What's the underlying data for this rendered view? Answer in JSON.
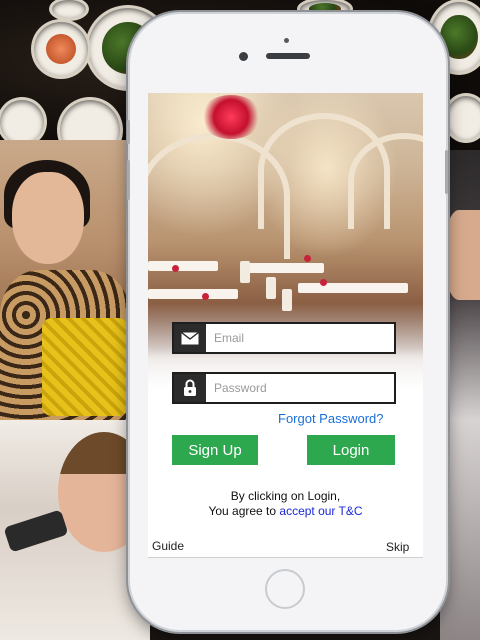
{
  "login": {
    "email_placeholder": "Email",
    "password_placeholder": "Password",
    "forgot_password": "Forgot Password?",
    "signup_label": "Sign Up",
    "login_label": "Login"
  },
  "terms": {
    "line1": "By clicking on Login,",
    "line2_prefix": "You agree to ",
    "link": "accept our T&C"
  },
  "footer": {
    "guide": "Guide",
    "skip": "Skip"
  },
  "colors": {
    "button_green": "#2ea84f",
    "link_blue": "#1a6fd6",
    "terms_link": "#1a2ad8"
  },
  "icons": {
    "email": "envelope-icon",
    "password": "lock-icon"
  }
}
